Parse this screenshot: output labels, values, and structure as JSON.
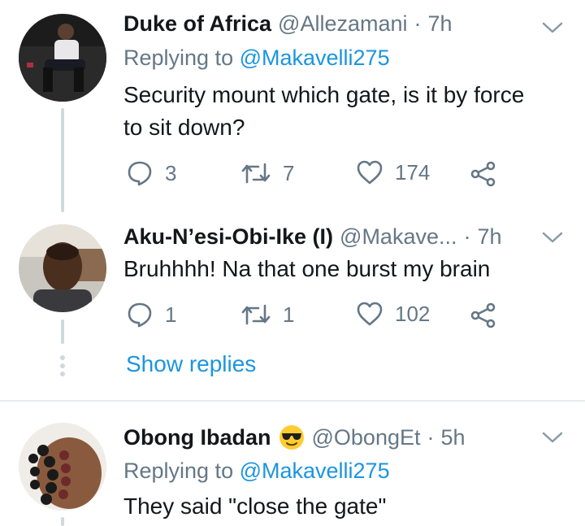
{
  "tweets": [
    {
      "name": "Duke of Africa",
      "handle": "@Allezamani",
      "sep": "·",
      "time": "7h",
      "replying_prefix": "Replying to ",
      "replying_to": "@Makavelli275",
      "text_line1": "Security mount which gate, is it by force",
      "text_line2": "to sit down?",
      "replies": "3",
      "retweets": "7",
      "likes": "174"
    },
    {
      "name": "Aku-N’esi-Obi-Ike (I)",
      "handle": "@Makave...",
      "sep": "·",
      "time": "7h",
      "text_line1": "Bruhhhh! Na that one burst my brain",
      "replies": "1",
      "retweets": "1",
      "likes": "102"
    },
    {
      "name": "Obong Ibadan",
      "emoji": "cool-sunglasses-emoji",
      "handle": "@ObongEt",
      "sep": "·",
      "time": "5h",
      "replying_prefix": "Replying to ",
      "replying_to": "@Makavelli275",
      "text_line1": "They said \"close the gate\""
    }
  ],
  "show_replies": "Show replies",
  "colors": {
    "link": "#1b95e0",
    "secondary": "#657786",
    "text": "#14171a",
    "divider": "#e6ecf0"
  }
}
